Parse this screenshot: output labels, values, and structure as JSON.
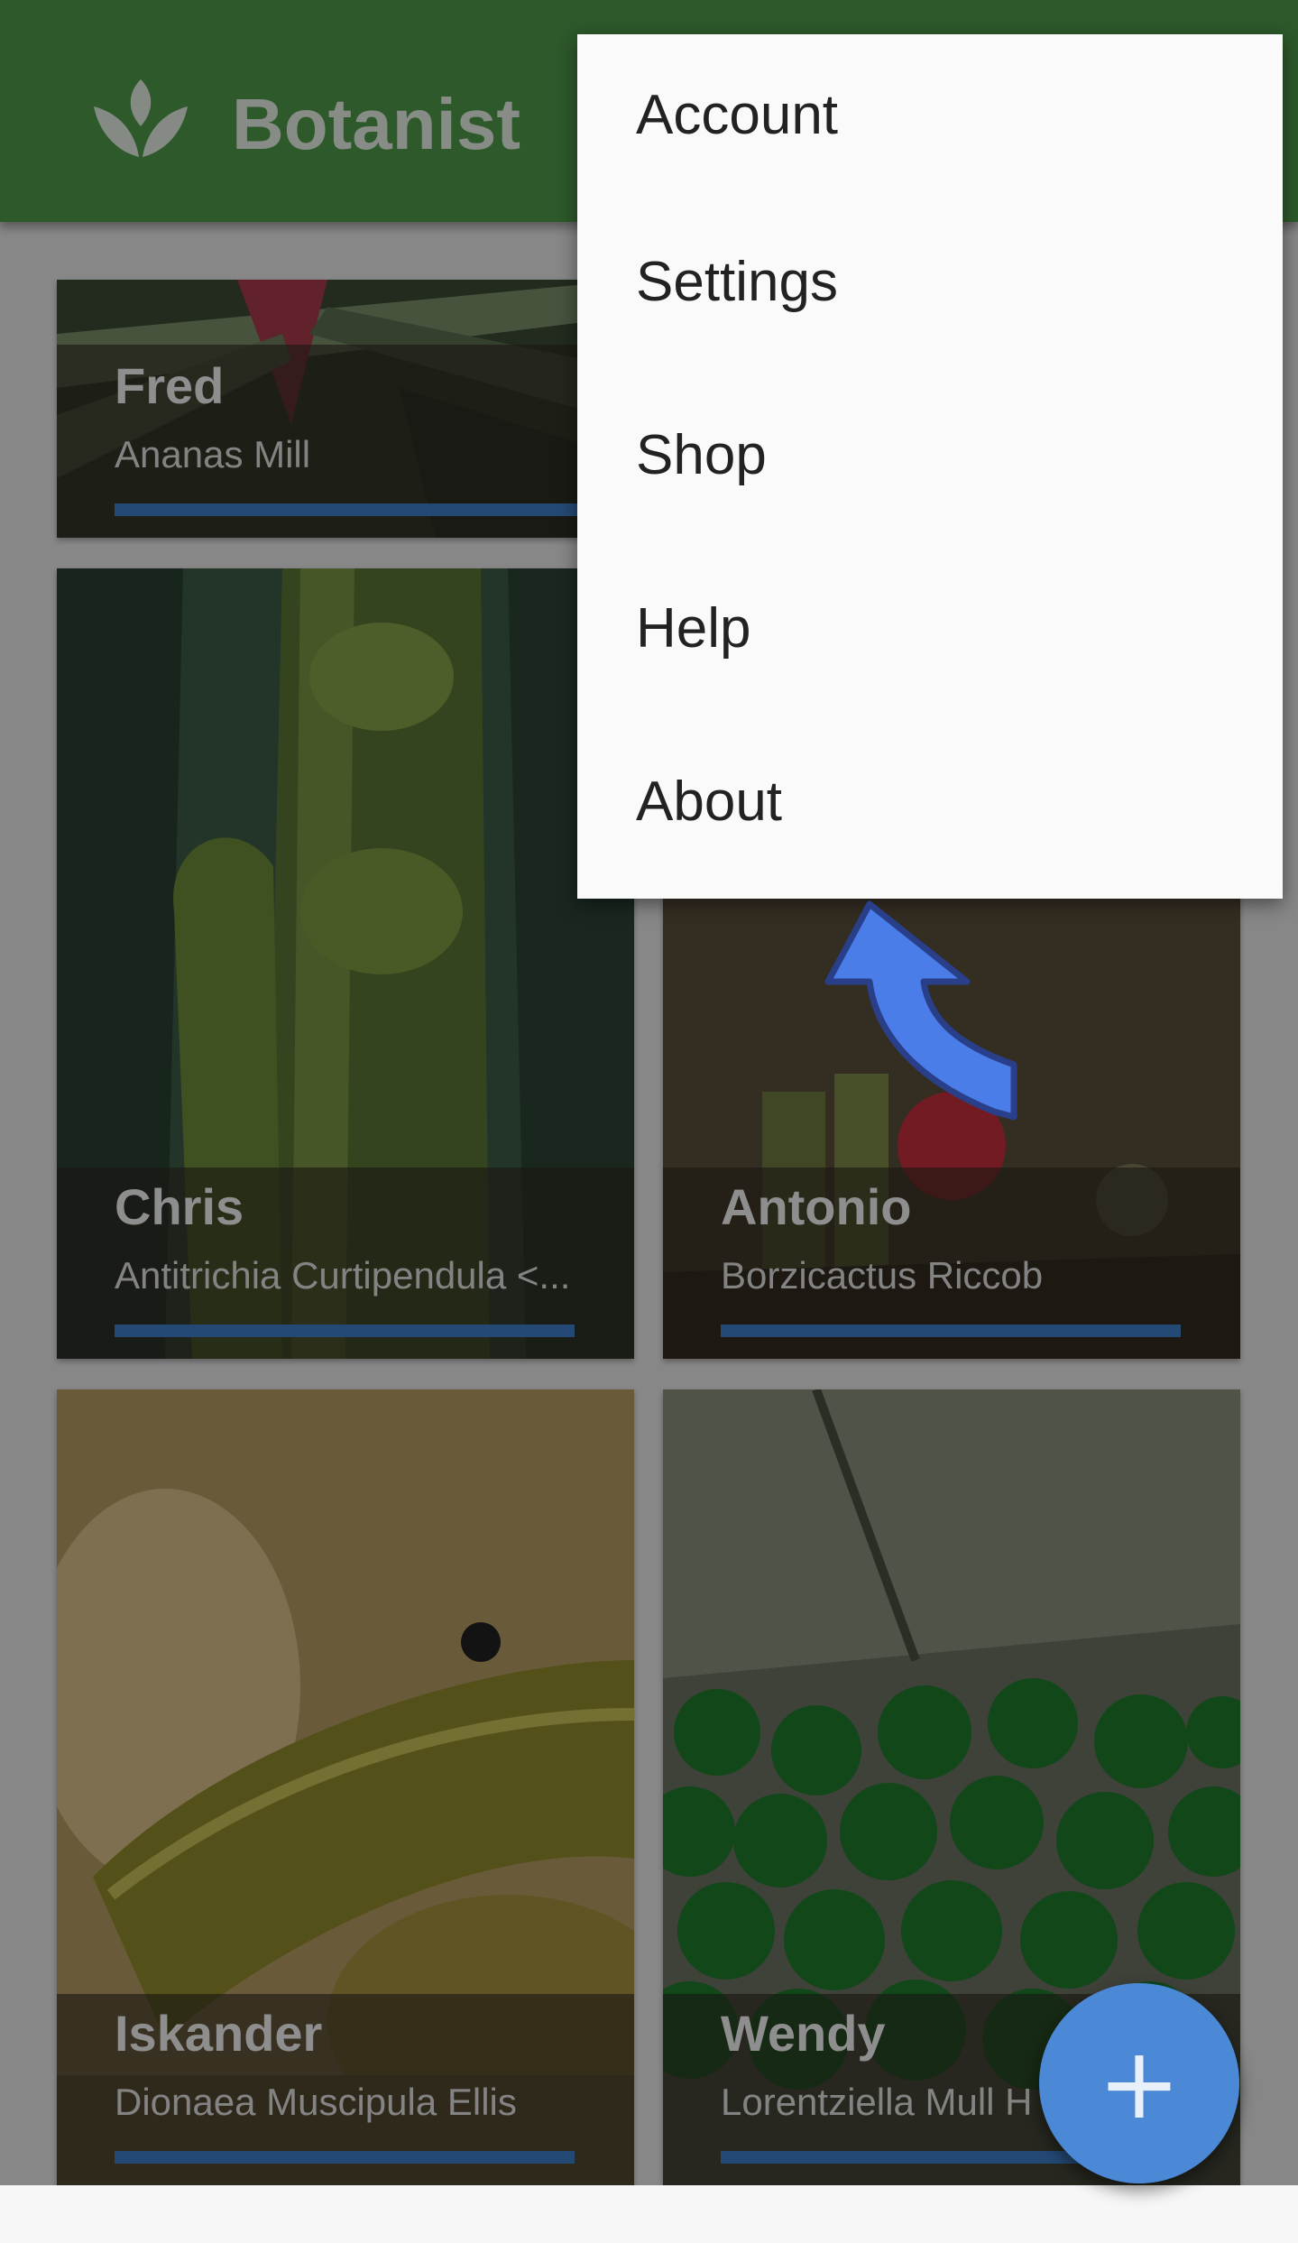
{
  "app": {
    "title": "Botanist",
    "logo_icon": "leaf-icon"
  },
  "menu": {
    "items": [
      {
        "label": "Account"
      },
      {
        "label": "Settings"
      },
      {
        "label": "Shop"
      },
      {
        "label": "Help"
      },
      {
        "label": "About"
      }
    ]
  },
  "plants": [
    {
      "name": "Fred",
      "species": "Ananas Mill",
      "water_level": 1.0
    },
    {
      "name": "Chris",
      "species": "Antitrichia Curtipendula <...",
      "water_level": 1.0
    },
    {
      "name": "Antonio",
      "species": "Borzicactus Riccob",
      "water_level": 1.0
    },
    {
      "name": "Iskander",
      "species": "Dionaea Muscipula Ellis",
      "water_level": 1.0
    },
    {
      "name": "Wendy",
      "species": "Lorentziella Mull H",
      "water_level": 1.0
    }
  ],
  "fab": {
    "icon": "plus-icon",
    "label": "+"
  },
  "colors": {
    "appbar": "#4e9a4a",
    "accent": "#3e7fc8",
    "fab": "#4b88d6"
  },
  "annotation": {
    "icon": "curved-arrow-icon",
    "color": "#4a7de8"
  }
}
